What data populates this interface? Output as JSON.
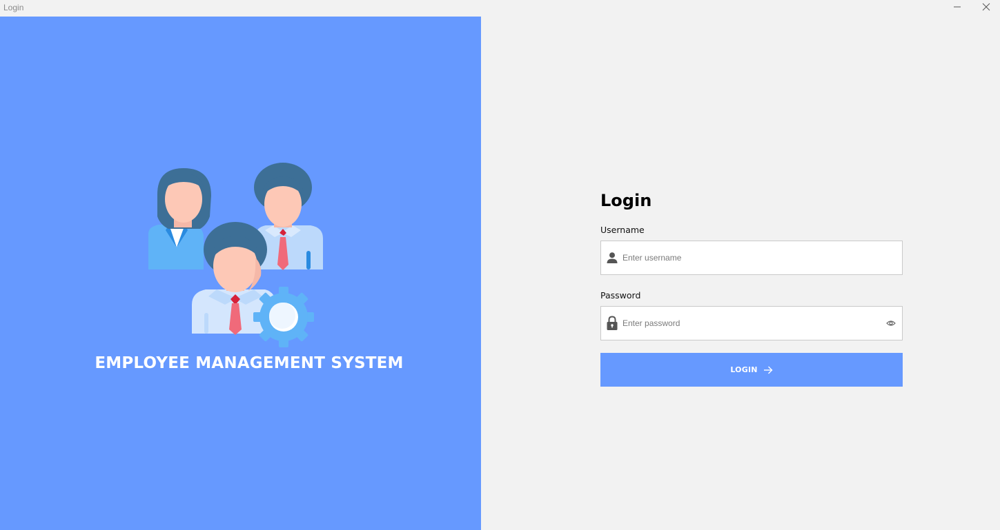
{
  "window": {
    "title": "Login",
    "minimize_icon": "minimize-icon",
    "close_icon": "close-icon"
  },
  "branding": {
    "app_name": "EMPLOYEE MANAGEMENT SYSTEM",
    "illustration": "team-gear-illustration",
    "panel_color": "#6699ff"
  },
  "form": {
    "title": "Login",
    "username": {
      "label": "Username",
      "placeholder": "Enter username",
      "value": "",
      "icon": "user-icon"
    },
    "password": {
      "label": "Password",
      "placeholder": "Enter password",
      "value": "",
      "icon": "lock-icon",
      "toggle_icon": "eye-icon"
    },
    "submit": {
      "label": "LOGIN",
      "icon": "arrow-right-icon",
      "color": "#6699ff"
    }
  }
}
